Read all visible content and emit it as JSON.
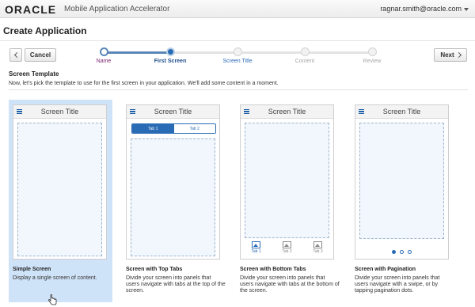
{
  "topbar": {
    "logo": "ORACLE",
    "app_title": "Mobile Application Accelerator",
    "user": "ragnar.smith@oracle.com"
  },
  "page_title": "Create Application",
  "nav": {
    "cancel_label": "Cancel",
    "next_label": "Next"
  },
  "train": {
    "steps": [
      {
        "label": "Name",
        "state": "done"
      },
      {
        "label": "First Screen",
        "state": "current"
      },
      {
        "label": "Screen Title",
        "state": "pending"
      },
      {
        "label": "Content",
        "state": "future"
      },
      {
        "label": "Review",
        "state": "future"
      }
    ]
  },
  "section": {
    "title": "Screen Template",
    "instructions": "Now, let's pick the template to use for the first screen in your application. We'll add some content in a moment."
  },
  "templates": [
    {
      "name": "Simple Screen",
      "description": "Display a single screen of content.",
      "screen_title": "Screen Title",
      "selected": true
    },
    {
      "name": "Screen with Top Tabs",
      "description": "Divide your screen into panels that users navigate with tabs at the top of the screen.",
      "screen_title": "Screen Title",
      "tabs": [
        "Tab 1",
        "Tab 2"
      ],
      "selected": false
    },
    {
      "name": "Screen with Bottom Tabs",
      "description": "Divide your screen into panels that users navigate with tabs at the bottom of the screen.",
      "screen_title": "Screen Title",
      "tabs": [
        "Tab 1",
        "Tab 2",
        "Tab 3"
      ],
      "selected": false
    },
    {
      "name": "Screen with Pagination",
      "description": "Divide your screen into panels that users navigate with a swipe, or by tapping pagination dots.",
      "screen_title": "Screen Title",
      "selected": false
    }
  ],
  "colors": {
    "accent": "#2a6bb5",
    "selected_tile": "#cfe3f8",
    "done_step": "#7a1f6e"
  }
}
